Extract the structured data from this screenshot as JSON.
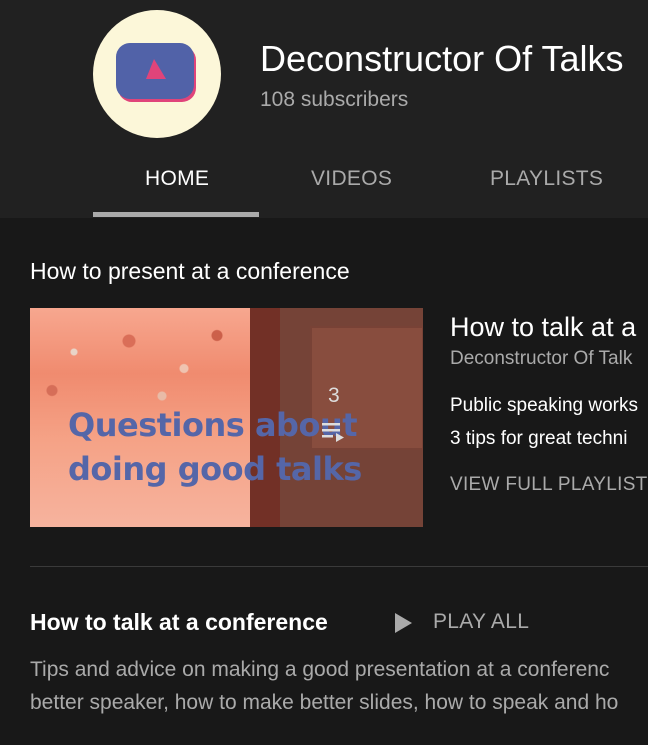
{
  "channel": {
    "title": "Deconstructor Of Talks",
    "subscribers": "108 subscribers",
    "avatar_icon": "play-logo-icon",
    "avatar_bg": "#fcf7d9"
  },
  "tabs": [
    {
      "label": "HOME",
      "active": true
    },
    {
      "label": "VIDEOS",
      "active": false
    },
    {
      "label": "PLAYLISTS",
      "active": false
    }
  ],
  "section": {
    "title": "How to present at a conference"
  },
  "playlist": {
    "thumbnail_text_line1": "Questions about",
    "thumbnail_text_line2": "doing good talks",
    "video_count": "3",
    "title": "How to talk at a",
    "channel": "Deconstructor Of Talk",
    "videos": [
      "Public speaking works",
      "3 tips for great techni"
    ],
    "view_full": "VIEW FULL PLAYLIST"
  },
  "shelf": {
    "title": "How to talk at a conference",
    "play_all": "PLAY ALL",
    "description_line1": "Tips and advice on making a good presentation at a conferenc",
    "description_line2": "better speaker, how to make better slides, how to speak and ho"
  },
  "colors": {
    "background": "#181818",
    "header_bg": "#212121",
    "secondary_text": "#aaaaaa",
    "thumbnail_accent": "#f28468",
    "thumbnail_text": "#5566a8"
  }
}
